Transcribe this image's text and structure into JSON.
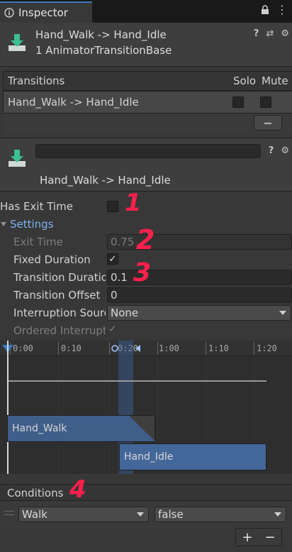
{
  "tab": {
    "title": "Inspector"
  },
  "header": {
    "title": "Hand_Walk -> Hand_Idle",
    "subtitle": "1 AnimatorTransitionBase"
  },
  "transitions": {
    "columns": [
      "Transitions",
      "Solo",
      "Mute"
    ],
    "rows": [
      {
        "name": "Hand_Walk -> Hand_Idle",
        "solo": false,
        "mute": false
      }
    ],
    "remove_label": "−"
  },
  "detail": {
    "name_value": "",
    "title": "Hand_Walk -> Hand_Idle"
  },
  "props": {
    "has_exit_time_label": "Has Exit Time",
    "has_exit_time": false,
    "settings_label": "Settings",
    "exit_time_label": "Exit Time",
    "exit_time_value": "0.75",
    "fixed_duration_label": "Fixed Duration",
    "fixed_duration": true,
    "transition_duration_label": "Transition Duration",
    "transition_duration_value": "0.1",
    "transition_offset_label": "Transition Offset",
    "transition_offset_value": "0",
    "interruption_source_label": "Interruption Source",
    "interruption_source_value": "None",
    "ordered_interruption_label": "Ordered Interruption",
    "ordered_interruption": true
  },
  "timeline": {
    "ticks": [
      "0:00",
      "0:10",
      "0:20",
      "1:00",
      "1:10",
      "1:20"
    ],
    "clip_from": "Hand_Walk",
    "clip_to": "Hand_Idle"
  },
  "conditions": {
    "title": "Conditions",
    "parameter": "Walk",
    "value": "false",
    "add_label": "+",
    "remove_label": "−"
  },
  "annotations": [
    "1",
    "2",
    "3",
    "4"
  ],
  "colors": {
    "accent": "#3a79bb",
    "annotation": "#ff1f4c",
    "settings_blue": "#7fb1f0"
  }
}
